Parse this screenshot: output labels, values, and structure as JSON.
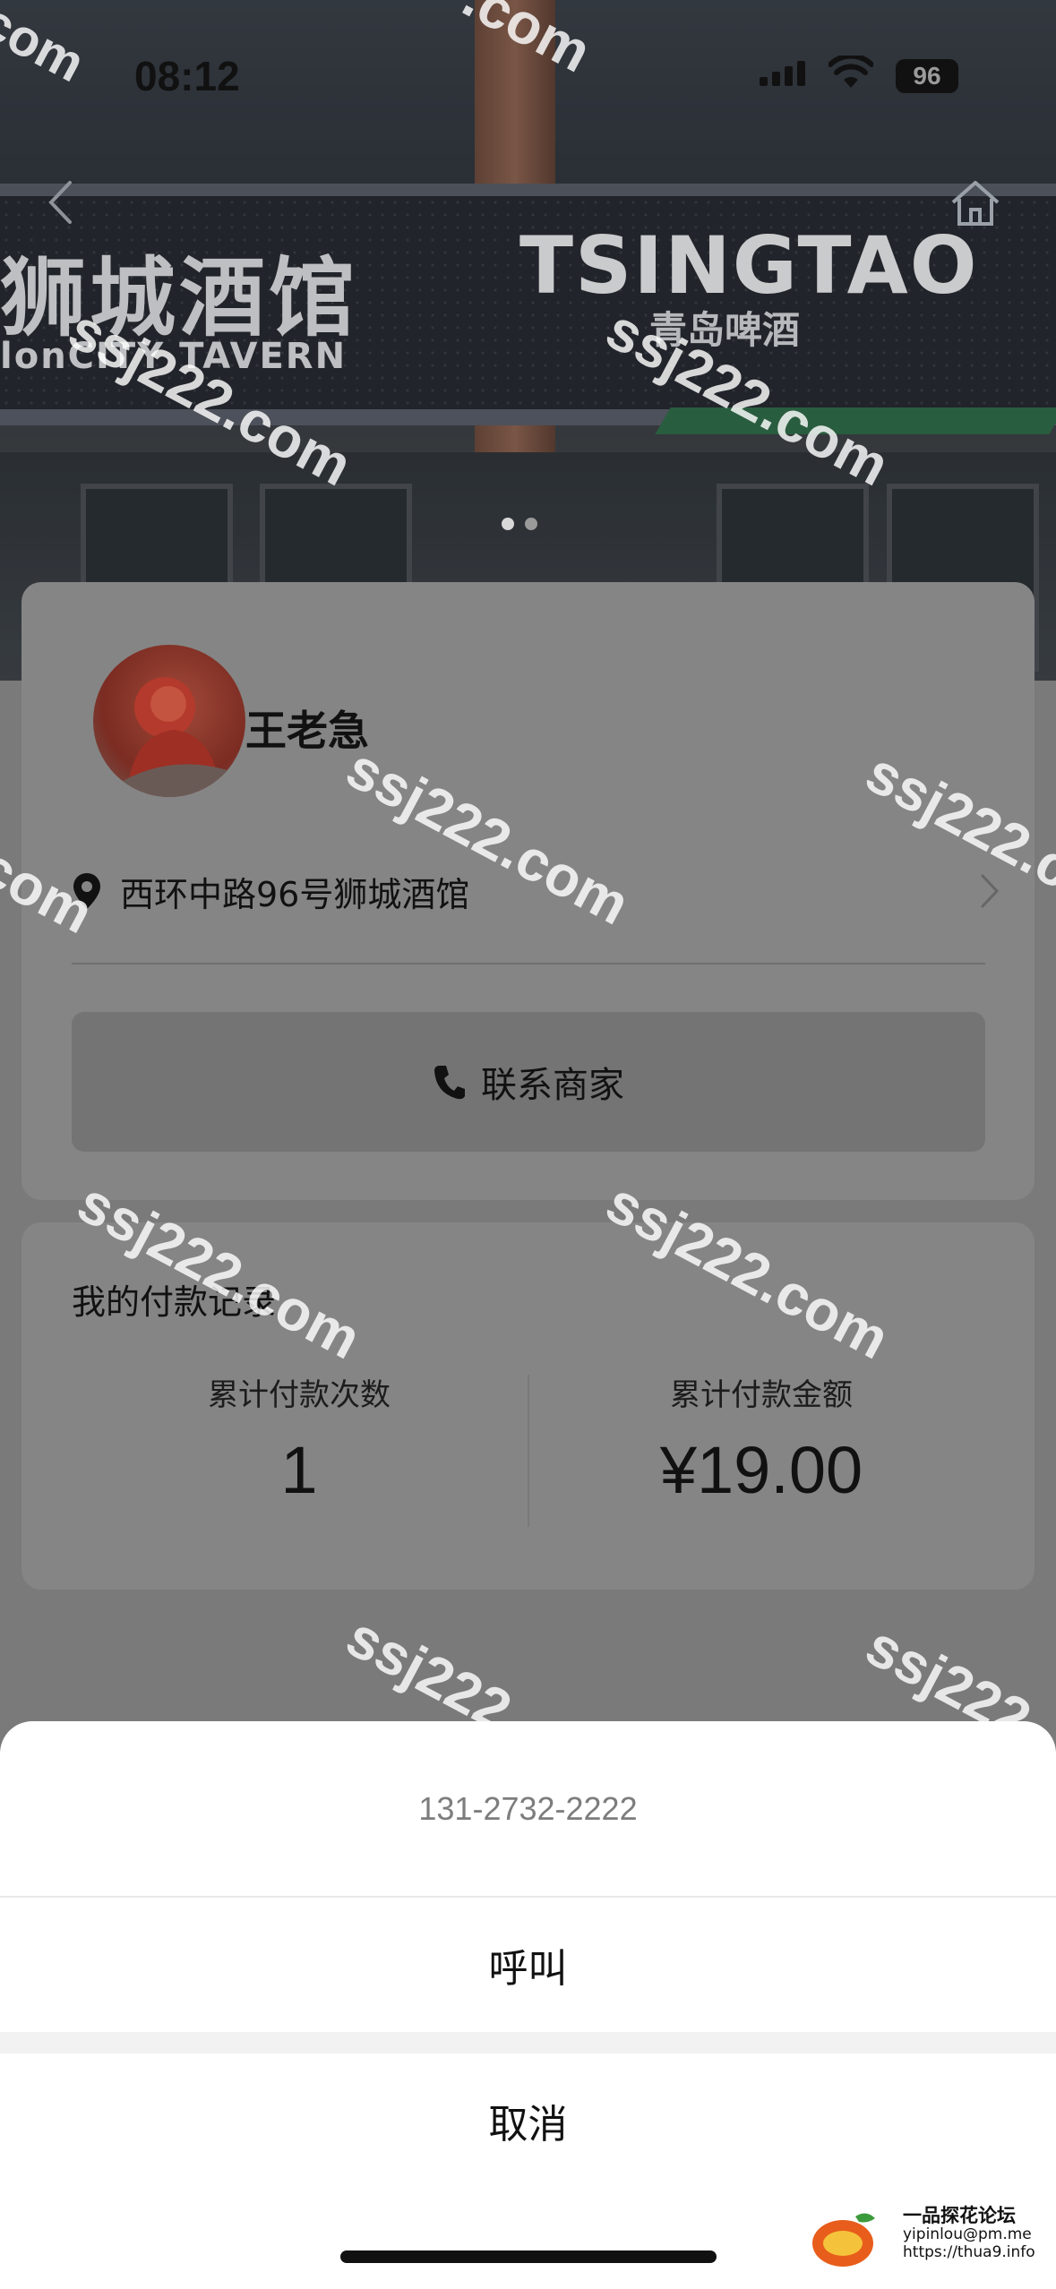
{
  "status_bar": {
    "time": "08:12",
    "battery": "96"
  },
  "photo": {
    "sign_cn": "狮城酒馆",
    "sign_en": "lonCITY TAVERN",
    "brand": "TSINGTAO",
    "brand_sub": "青岛啤酒"
  },
  "merchant": {
    "name": "王老急",
    "address": "西环中路96号狮城酒馆",
    "contact_label": "联系商家"
  },
  "payment": {
    "title": "我的付款记录",
    "count_label": "累计付款次数",
    "count_value": "1",
    "amount_label": "累计付款金额",
    "amount_value": "¥19.00"
  },
  "action_sheet": {
    "phone": "131-2732-2222",
    "call": "呼叫",
    "cancel": "取消"
  },
  "watermarks": [
    "ssj222.com",
    "ssj222.com",
    "ssj222.com",
    "ssj222.com",
    "ssj222.com",
    "ssj222.com",
    "ssj222",
    "ssj222",
    ".com",
    "com",
    "com"
  ],
  "forum": {
    "name": "一品探花论坛",
    "email": "yipinlou@pm.me",
    "url": "https://thua9.info"
  },
  "colors": {
    "overlay_gray": "#858585",
    "sheet_bg": "#ffffff",
    "text_dark": "#111111",
    "phone_text": "#7d7d7d"
  }
}
